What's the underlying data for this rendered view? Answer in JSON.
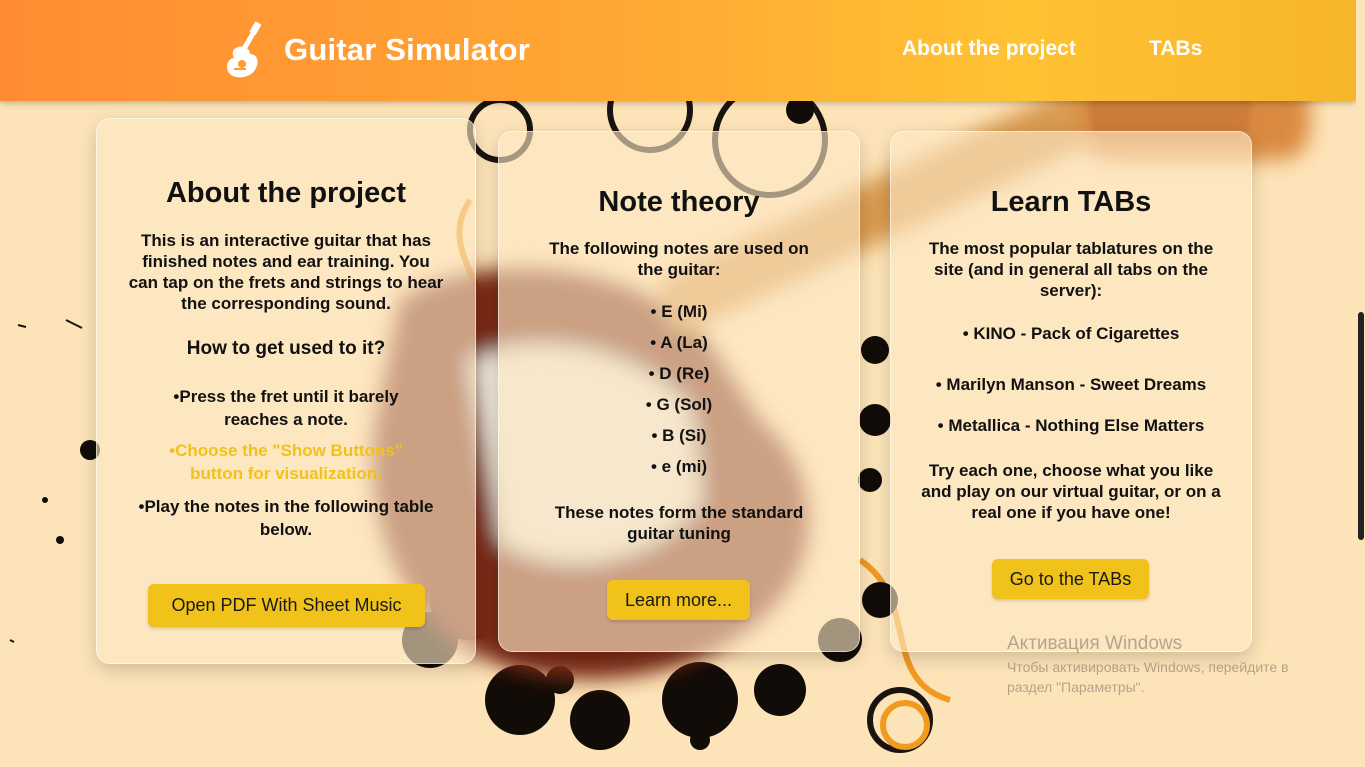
{
  "header": {
    "title": "Guitar Simulator",
    "nav": [
      "About the project",
      "TABs"
    ]
  },
  "cards": {
    "about": {
      "title": "About the project",
      "intro": "This is an interactive guitar that has finished notes and ear training. You can tap on the frets and strings to hear the corresponding sound.",
      "subtitle": "How to get used to it?",
      "steps": [
        "•Press the fret until it barely reaches a note.",
        "•Choose the \"Show Buttons\" button for visualization.",
        "•Play the notes in the following table below."
      ],
      "button": "Open PDF With Sheet Music"
    },
    "notes": {
      "title": "Note theory",
      "intro": "The following notes are used on the guitar:",
      "items": [
        "• E (Mi)",
        "• A (La)",
        "• D (Re)",
        "• G (Sol)",
        "• B (Si)",
        "• e (mi)"
      ],
      "outro": "These notes form the standard guitar tuning",
      "button": "Learn more..."
    },
    "tabs": {
      "title": "Learn TABs",
      "intro": "The most popular tablatures on the site (and in general all tabs on the server):",
      "items": [
        "• KINO - Pack of Cigarettes",
        "• Marilyn Manson - Sweet Dreams",
        "• Metallica - Nothing Else Matters"
      ],
      "outro": "Try each one, choose what you like and play on our virtual guitar, or on a real one if you have one!",
      "button": "Go to the TABs"
    }
  },
  "watermark": {
    "title": "Активация Windows",
    "line1": "Чтобы активировать Windows, перейдите в",
    "line2": "раздел \"Параметры\"."
  },
  "colors": {
    "accent": "#f0c21a",
    "highlight_text": "#f0c21a",
    "header_start": "#ff8c33",
    "header_end": "#f6b52a"
  }
}
